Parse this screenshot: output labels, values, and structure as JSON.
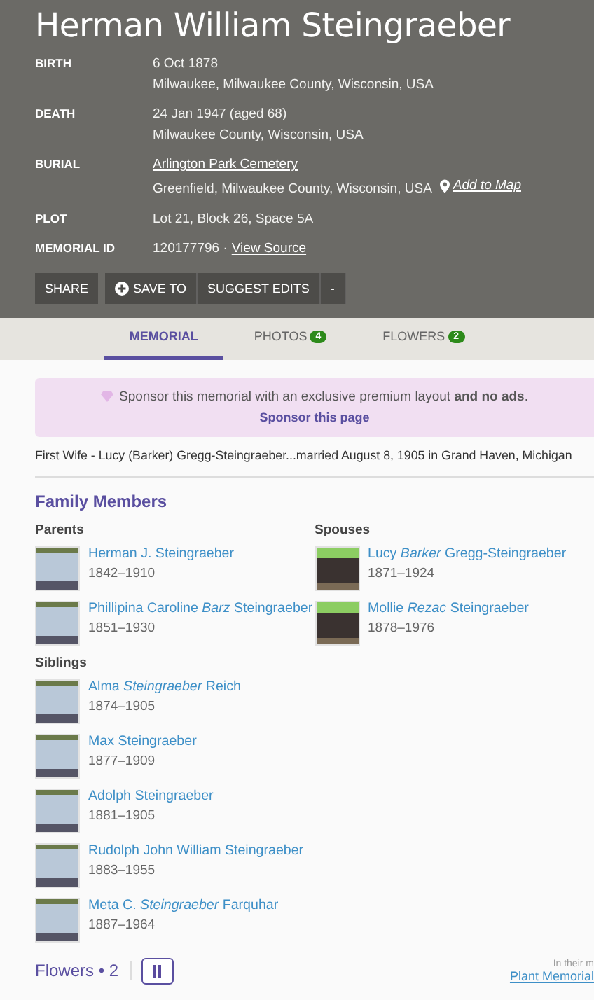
{
  "header": {
    "name": "Herman William Steingraeber",
    "facts": [
      {
        "label": "BIRTH",
        "lines": [
          "6 Oct 1878",
          "Milwaukee, Milwaukee County, Wisconsin, USA"
        ]
      },
      {
        "label": "DEATH",
        "lines": [
          "24 Jan 1947 (aged 68)",
          "Milwaukee County, Wisconsin, USA"
        ]
      },
      {
        "label": "BURIAL",
        "link": "Arlington Park Cemetery",
        "lines": [
          "Greenfield, Milwaukee County, Wisconsin, USA"
        ],
        "map_link": "Add to Map"
      },
      {
        "label": "PLOT",
        "lines": [
          "Lot 21, Block 26, Space 5A"
        ]
      },
      {
        "label": "MEMORIAL ID",
        "lines": [
          "120177796 ·"
        ],
        "source_link": "View Source"
      }
    ],
    "buttons": [
      {
        "label": "SHARE",
        "kind": "plain"
      },
      {
        "label": "SAVE TO",
        "kind": "save"
      },
      {
        "label": "SUGGEST EDITS",
        "kind": "plain"
      },
      {
        "label": "-",
        "kind": "plain"
      }
    ]
  },
  "tabs": [
    {
      "label": "MEMORIAL",
      "selected": true
    },
    {
      "label": "PHOTOS",
      "count": "4",
      "selected": false
    },
    {
      "label": "FLOWERS",
      "count": "2",
      "selected": false
    }
  ],
  "sponsor": {
    "text": "Sponsor this memorial with an exclusive premium layout **and no ads**.",
    "link": "Sponsor this page"
  },
  "bio": "First Wife - Lucy (Barker) Gregg-Steingraeber...married August 8, 1905 in Grand Haven, Michigan",
  "family": {
    "title": "Family Members",
    "columns": [
      [
        {
          "title": "Parents",
          "members": [
            {
              "name": "Herman J. Steingraeber",
              "years": "1842–1910"
            },
            {
              "name": "Phillipina Caroline *Barz* Steingraeber",
              "years": "1851–1930"
            }
          ]
        },
        {
          "title": "Siblings",
          "members": [
            {
              "name": "Alma *Steingraeber* Reich",
              "years": "1874–1905"
            },
            {
              "name": "Max Steingraeber",
              "years": "1877–1909"
            },
            {
              "name": "Adolph Steingraeber",
              "years": "1881–1905"
            },
            {
              "name": "Rudolph John William Steingraeber",
              "years": "1883–1955"
            },
            {
              "name": "Meta C. *Steingraeber* Farquhar",
              "years": "1887–1964"
            }
          ]
        }
      ],
      [
        {
          "title": "Spouses",
          "members": [
            {
              "name": "Lucy *Barker* Gregg-Steingraeber",
              "years": "1871–1924"
            },
            {
              "name": "Mollie *Rezac* Steingraeber",
              "years": "1878–1976"
            }
          ]
        }
      ]
    ]
  },
  "flowers": {
    "title": "Flowers • 2",
    "note": "In their m",
    "link": "Plant Memorial"
  }
}
